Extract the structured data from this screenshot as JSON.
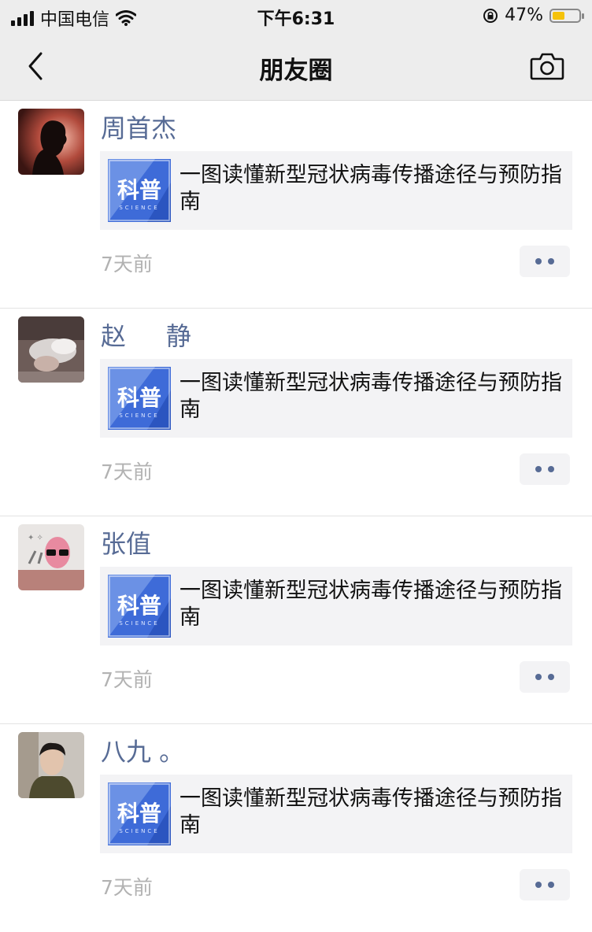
{
  "status_bar": {
    "carrier": "中国电信",
    "time": "下午6:31",
    "battery_percent": "47%",
    "battery_level": 0.47
  },
  "nav": {
    "title": "朋友圈",
    "back_icon": "chevron-left-icon",
    "camera_icon": "camera-icon"
  },
  "thumb": {
    "main": "科普",
    "sub": "SCIENCE"
  },
  "posts": [
    {
      "user": "周首杰",
      "link_title": "一图读懂新型冠状病毒传播途径与预防指南",
      "time": "7天前"
    },
    {
      "user": "赵     静",
      "link_title": "一图读懂新型冠状病毒传播途径与预防指南",
      "time": "7天前"
    },
    {
      "user": "张值",
      "link_title": "一图读懂新型冠状病毒传播途径与预防指南",
      "time": "7天前"
    },
    {
      "user": "八九 。",
      "link_title": "一图读懂新型冠状病毒传播途径与预防指南",
      "time": "7天前"
    }
  ],
  "colors": {
    "nickname": "#576b95",
    "bar_bg": "#ededed",
    "card_bg": "#f3f3f5",
    "time": "#b2b2b2"
  }
}
